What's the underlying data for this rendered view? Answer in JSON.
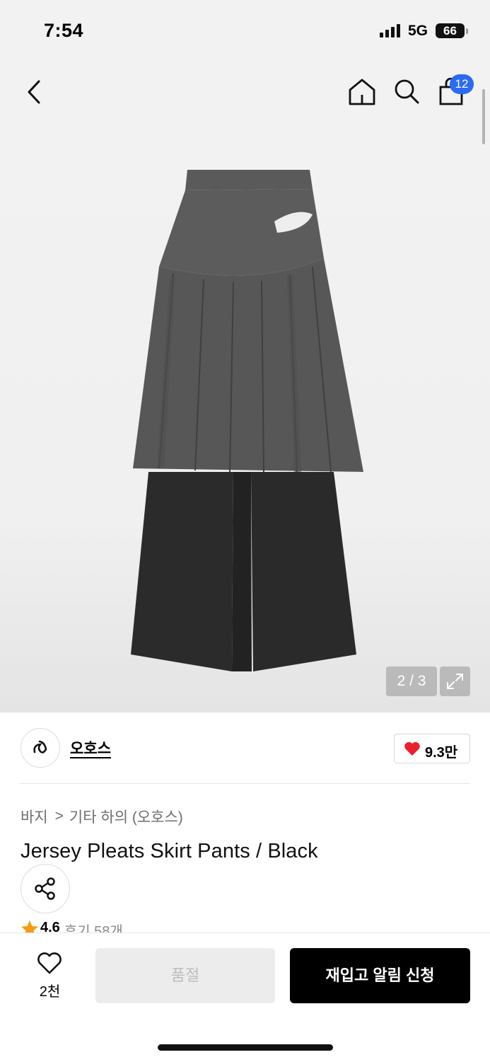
{
  "status_bar": {
    "time": "7:54",
    "network": "5G",
    "battery": "66"
  },
  "header": {
    "cart_badge": "12",
    "icons": [
      "chevron-left-icon",
      "home-icon",
      "search-icon",
      "shopping-bag-icon"
    ]
  },
  "gallery": {
    "counter": "2 / 3",
    "expand_icon": "expand-icon"
  },
  "brand": {
    "name": "오호스",
    "like_count": "9.3만"
  },
  "breadcrumb": {
    "category": "바지",
    "separator": ">",
    "subcategory": "기타 하의 (오호스)"
  },
  "product": {
    "title": "Jersey Pleats Skirt Pants / Black"
  },
  "rating": {
    "score": "4.6",
    "reviews": "후기 58개"
  },
  "bottom_bar": {
    "wishlist_count": "2천",
    "soldout_label": "품절",
    "restock_label": "재입고 알림 신청"
  },
  "colors": {
    "badge_blue": "#2a6bf2",
    "heart_red": "#e8212d",
    "star_orange": "#f39c12"
  }
}
